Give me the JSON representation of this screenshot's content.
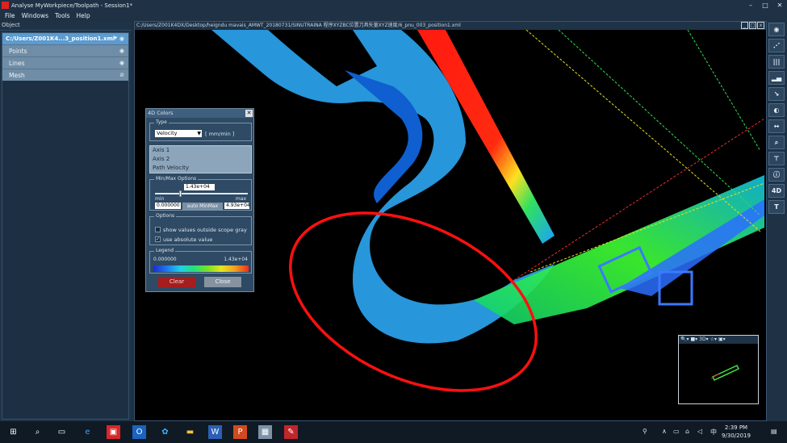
{
  "window": {
    "title": "Analyse MyWorkpiece/Toolpath - Session1*"
  },
  "menu": [
    "File",
    "Windows",
    "Tools",
    "Help"
  ],
  "left_panel": {
    "header": "Object",
    "root": "C:/Users/Z001K4...3_position1.xml",
    "items": [
      "Points",
      "Lines",
      "Mesh"
    ]
  },
  "viewport": {
    "path": "C:/Users/Z001K4DX/Desktop/heigndu mavais_AMWT_20180731/SINUTRAINA 程序XYZBC位置刀具矢量XYZ速度/6_pnu_003_position1.xml"
  },
  "dialog": {
    "title": "4D Colors",
    "type_label": "Type",
    "type_value": "Velocity",
    "unit": "[ mm/min ]",
    "list": [
      "Axis 1",
      "Axis 2",
      "Path Velocity"
    ],
    "minmax_label": "Min/Max Options",
    "current_value": "1.43e+04",
    "min_label": "min",
    "max_label": "max",
    "min_value": "0.000000",
    "max_value": "4.93e+04",
    "auto_label": "auto MinMax",
    "options_label": "Options",
    "opt1": "show values outside scope gray",
    "opt2": "use absolute value",
    "legend_label": "Legend",
    "legend_min": "0.000000",
    "legend_max": "1.43e+04",
    "clear": "Clear",
    "close": "Close"
  },
  "right_toolbar": [
    "eye-icon",
    "points-icon",
    "bars-icon",
    "chart-icon",
    "axis-icon",
    "color-icon",
    "measure-icon",
    "zoom-icon",
    "tool-icon",
    "info-icon",
    "4D",
    "T"
  ],
  "taskbar": {
    "time": "2:39 PM",
    "date": "9/30/2019"
  }
}
